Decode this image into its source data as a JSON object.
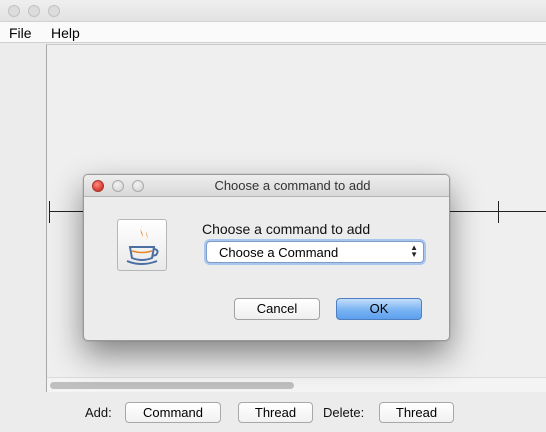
{
  "menubar": {
    "file_label": "File",
    "help_label": "Help"
  },
  "bottom": {
    "add_label": "Add:",
    "command_button": "Command",
    "thread_button": "Thread",
    "delete_label": "Delete:",
    "delete_thread_button": "Thread"
  },
  "dialog": {
    "title": "Choose a command to add",
    "prompt": "Choose a command to add",
    "select_value": "Choose a Command",
    "cancel_label": "Cancel",
    "ok_label": "OK",
    "icon": "java-cup-icon"
  },
  "colors": {
    "ok_button": "#5d9fee",
    "close_light": "#e0443a",
    "focus_ring": "#a9c6ef"
  }
}
